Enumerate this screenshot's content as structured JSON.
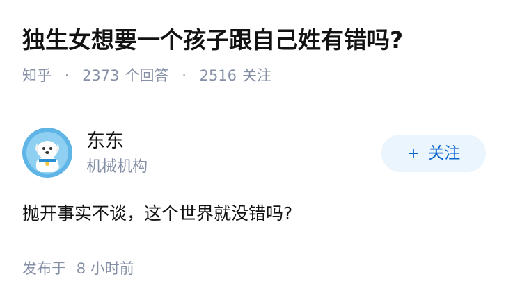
{
  "question": {
    "title": "独生女想要一个孩子跟自己姓有错吗?",
    "source": "知乎",
    "answers_count": "2373",
    "answers_unit": "个回答",
    "followers_count": "2516",
    "followers_unit": "关注",
    "separator": "·"
  },
  "author": {
    "name": "东东",
    "headline": "机械机构",
    "avatar_icon": "dog-mascot-avatar",
    "follow_plus": "+",
    "follow_label": "关注"
  },
  "answer": {
    "text": "抛开事实不谈，这个世界就没错吗?",
    "published_prefix": "发布于",
    "published_time": "8 小时前"
  },
  "colors": {
    "title": "#121212",
    "meta": "#8590a6",
    "follow_bg": "#ebf5fd",
    "follow_text": "#0d66d0",
    "avatar_bg": "#5fb6e6"
  }
}
